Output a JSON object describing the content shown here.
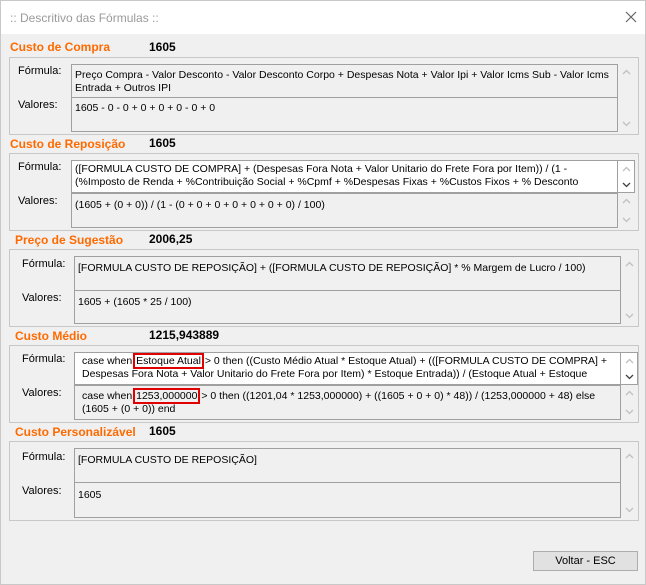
{
  "window": {
    "title": ":: Descritivo das Fórmulas ::"
  },
  "labels": {
    "formula": "Fórmula:",
    "valores": "Valores:"
  },
  "sections": [
    {
      "title": "Custo de Compra",
      "value": "1605",
      "formula": "Preço Compra - Valor Desconto - Valor Desconto Corpo + Despesas Nota + Valor Ipi + Valor Icms Sub - Valor Icms Entrada + Outros IPI",
      "valores": "1605 - 0 - 0 + 0 + 0 + 0 - 0 + 0"
    },
    {
      "title": "Custo de Reposição",
      "value": "1605",
      "formula": "([FORMULA CUSTO DE COMPRA] + (Despesas Fora Nota + Valor Unitario do Frete Fora por Item)) / (1 - (%Imposto de Renda + %Contribuição Social + %Cpmf + %Despesas Fixas + %Custos Fixos + % Desconto",
      "valores": "(1605 + (0 + 0)) / (1 - (0 + 0 + 0 + 0 + 0 + 0 + 0) / 100)"
    },
    {
      "title": "Preço de Sugestão",
      "value": "2006,25",
      "formula": "[FORMULA CUSTO DE REPOSIÇÃO] + ([FORMULA CUSTO DE REPOSIÇÃO] * % Margem de Lucro / 100)",
      "valores": "1605 + (1605 * 25 / 100)"
    },
    {
      "title": "Custo Médio",
      "value": "1215,943889",
      "formula_pre": "case when ",
      "formula_highlight": "Estoque Atual",
      "formula_post": " > 0 then ((Custo Médio Atual * Estoque Atual) + (([FORMULA CUSTO DE COMPRA] + Despesas Fora Nota + Valor Unitario do Frete Fora por Item) * Estoque Entrada)) / (Estoque Atual + Estoque",
      "valores_pre": "case when ",
      "valores_highlight": "1253,000000",
      "valores_post": " > 0 then ((1201,04 * 1253,000000) + ((1605 + 0 + 0) * 48)) / (1253,000000 + 48) else (1605 + (0 + 0)) end"
    },
    {
      "title": "Custo Personalizável",
      "value": "1605",
      "formula": "[FORMULA CUSTO DE REPOSIÇÃO]",
      "valores": "1605"
    }
  ],
  "footer": {
    "close_label": "Voltar - ESC"
  }
}
